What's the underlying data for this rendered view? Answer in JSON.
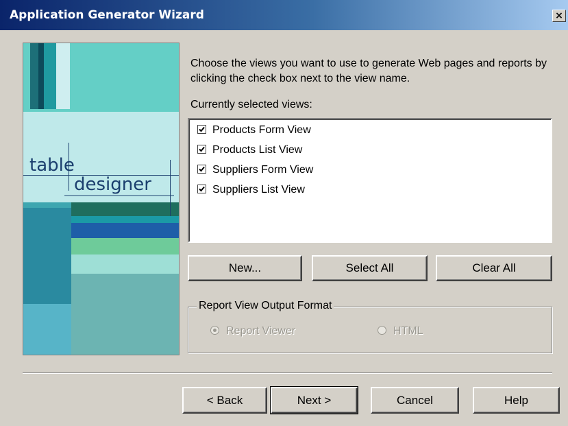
{
  "window": {
    "title": "Application Generator Wizard",
    "close_glyph": "×"
  },
  "banner": {
    "word_table": "table",
    "word_designer": "designer"
  },
  "instructions": "Choose the views you want to use to generate Web pages and reports by clicking the check box next to the view name.",
  "views_label": "Currently selected views:",
  "views": [
    {
      "label": "Products Form View",
      "checked": true
    },
    {
      "label": "Products List View",
      "checked": true
    },
    {
      "label": "Suppliers Form View",
      "checked": true
    },
    {
      "label": "Suppliers List View",
      "checked": true
    }
  ],
  "list_buttons": {
    "new": "New...",
    "select_all": "Select All",
    "clear_all": "Clear All"
  },
  "output_format": {
    "legend": "Report View Output Format",
    "options": [
      {
        "label": "Report Viewer",
        "selected": true,
        "enabled": false
      },
      {
        "label": "HTML",
        "selected": false,
        "enabled": false
      }
    ]
  },
  "nav_buttons": {
    "back": "< Back",
    "next": "Next >",
    "cancel": "Cancel",
    "help": "Help"
  },
  "colors": {
    "title_bar": "#0a246a",
    "dialog_bg": "#d4d0c8",
    "banner_teal": "#5ec4c0"
  }
}
